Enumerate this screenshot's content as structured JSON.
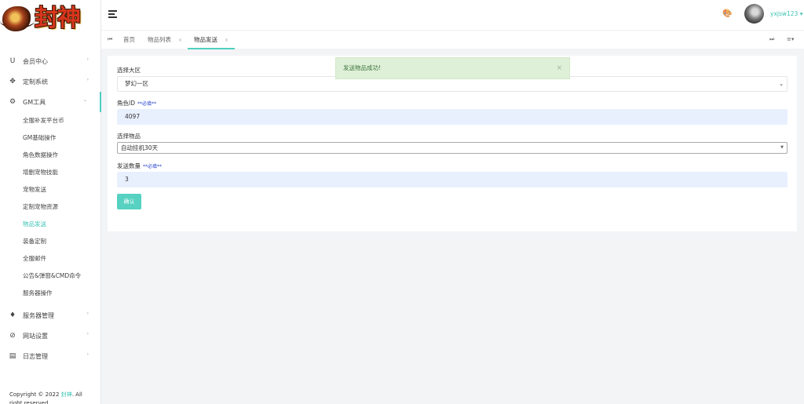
{
  "brand": {
    "logo_text": "封神"
  },
  "sidebar": {
    "items": [
      {
        "icon": "U",
        "icon_name": "user-shield-icon",
        "label": "会员中心"
      },
      {
        "icon": "✥",
        "icon_name": "custom-system-icon",
        "label": "定制系统"
      },
      {
        "icon": "⚙",
        "icon_name": "gm-tools-icon",
        "label": "GM工具"
      }
    ],
    "gm_sub_items": [
      "全服补发平台币",
      "GM基础操作",
      "角色数据操作",
      "增删宠物技能",
      "宠物发送",
      "定制宠物资源",
      "物品发送",
      "装备定制",
      "全服邮件",
      "公告&弹窗&CMD命令",
      "服务器操作"
    ],
    "bottom_items": [
      {
        "icon": "♦",
        "icon_name": "diamond-icon",
        "label": "服务器管理"
      },
      {
        "icon": "⊘",
        "icon_name": "globe-icon",
        "label": "网站设置"
      },
      {
        "icon": "▤",
        "icon_name": "log-icon",
        "label": "日志管理"
      }
    ],
    "chevron_icon_name": "chevron-right-icon",
    "copyright_prefix": "Copyright © 2022",
    "copyright_brand": "封神",
    "copyright_suffix": ". All right reserved"
  },
  "header": {
    "username": "yxjsw123",
    "palette_icon_name": "palette-icon",
    "tabs": [
      {
        "label": "首页"
      },
      {
        "label": "物品列表"
      },
      {
        "label": "物品发送"
      }
    ],
    "prev_icon": "⏮",
    "next_icon": "⏭",
    "menu_icon": "≡▾"
  },
  "form": {
    "server": {
      "label": "选择大区",
      "value": "梦幻一区"
    },
    "role_id": {
      "label": "角色ID",
      "required": "**必填**",
      "value": "4097"
    },
    "item": {
      "label": "选择物品",
      "value": "自动挂机30天"
    },
    "quantity": {
      "label": "发送数量",
      "required": "**必填**",
      "value": "3"
    },
    "submit_label": "确认"
  },
  "toast": {
    "message": "发送物品成功!",
    "close": "×"
  },
  "colors": {
    "accent": "#3cc3b4",
    "button": "#56d1c2",
    "toast_bg": "#dff0d8",
    "required": "#1e3cc9"
  }
}
